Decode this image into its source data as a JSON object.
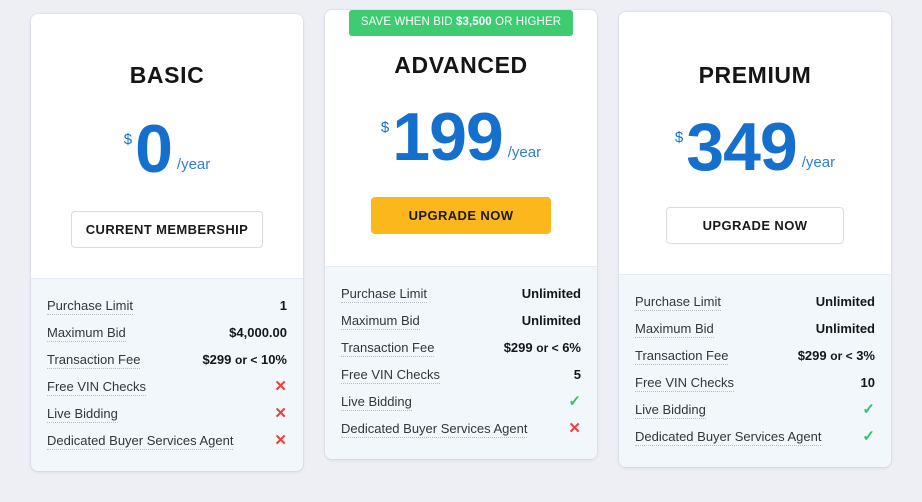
{
  "theme": {
    "page_background": "#eeeef5",
    "card_background": "#ffffff",
    "price_blue": "#1570cd",
    "badge_green": "#3ecc71",
    "cta_amber": "#fcb71d",
    "features_background": "#f2f7fb",
    "check_green": "#35c16b",
    "cross_red": "#e8443a"
  },
  "plans": [
    {
      "id": "basic",
      "name": "BASIC",
      "badge": null,
      "currency": "$",
      "amount": "0",
      "period": "/year",
      "cta_label": "CURRENT MEMBERSHIP",
      "cta_style": "outline",
      "features": [
        {
          "label": "Purchase Limit",
          "value": "1",
          "type": "text"
        },
        {
          "label": "Maximum Bid",
          "value": "$4,000.00",
          "type": "text"
        },
        {
          "label": "Transaction Fee",
          "value": "$299 or < 10%",
          "value_main": "$299",
          "value_op": "or <",
          "value_tail": "10%",
          "type": "fee"
        },
        {
          "label": "Free VIN Checks",
          "value": "✕",
          "type": "cross"
        },
        {
          "label": "Live Bidding",
          "value": "✕",
          "type": "cross"
        },
        {
          "label": "Dedicated Buyer Services Agent",
          "value": "✕",
          "type": "cross"
        }
      ]
    },
    {
      "id": "advanced",
      "name": "ADVANCED",
      "badge": {
        "prefix": "SAVE WHEN BID",
        "amount": "$3,500",
        "suffix": "OR HIGHER"
      },
      "currency": "$",
      "amount": "199",
      "period": "/year",
      "cta_label": "UPGRADE NOW",
      "cta_style": "solid",
      "features": [
        {
          "label": "Purchase Limit",
          "value": "Unlimited",
          "type": "text"
        },
        {
          "label": "Maximum Bid",
          "value": "Unlimited",
          "type": "text"
        },
        {
          "label": "Transaction Fee",
          "value": "$299 or < 6%",
          "value_main": "$299",
          "value_op": "or <",
          "value_tail": "6%",
          "type": "fee"
        },
        {
          "label": "Free VIN Checks",
          "value": "5",
          "type": "text"
        },
        {
          "label": "Live Bidding",
          "value": "✓",
          "type": "check"
        },
        {
          "label": "Dedicated Buyer Services Agent",
          "value": "✕",
          "type": "cross"
        }
      ]
    },
    {
      "id": "premium",
      "name": "PREMIUM",
      "badge": null,
      "currency": "$",
      "amount": "349",
      "period": "/year",
      "cta_label": "UPGRADE NOW",
      "cta_style": "outline",
      "features": [
        {
          "label": "Purchase Limit",
          "value": "Unlimited",
          "type": "text"
        },
        {
          "label": "Maximum Bid",
          "value": "Unlimited",
          "type": "text"
        },
        {
          "label": "Transaction Fee",
          "value": "$299 or < 3%",
          "value_main": "$299",
          "value_op": "or <",
          "value_tail": "3%",
          "type": "fee"
        },
        {
          "label": "Free VIN Checks",
          "value": "10",
          "type": "text"
        },
        {
          "label": "Live Bidding",
          "value": "✓",
          "type": "check"
        },
        {
          "label": "Dedicated Buyer Services Agent",
          "value": "✓",
          "type": "check"
        }
      ]
    }
  ]
}
